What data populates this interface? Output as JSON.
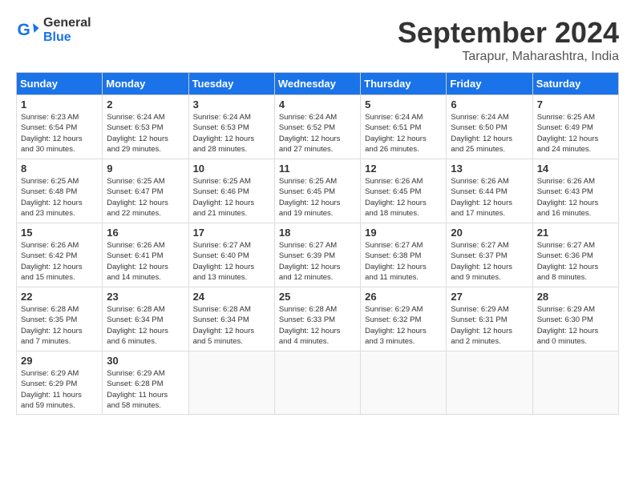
{
  "logo": {
    "text_general": "General",
    "text_blue": "Blue"
  },
  "header": {
    "month": "September 2024",
    "location": "Tarapur, Maharashtra, India"
  },
  "weekdays": [
    "Sunday",
    "Monday",
    "Tuesday",
    "Wednesday",
    "Thursday",
    "Friday",
    "Saturday"
  ],
  "weeks": [
    [
      {
        "day": "1",
        "info": "Sunrise: 6:23 AM\nSunset: 6:54 PM\nDaylight: 12 hours\nand 30 minutes."
      },
      {
        "day": "2",
        "info": "Sunrise: 6:24 AM\nSunset: 6:53 PM\nDaylight: 12 hours\nand 29 minutes."
      },
      {
        "day": "3",
        "info": "Sunrise: 6:24 AM\nSunset: 6:53 PM\nDaylight: 12 hours\nand 28 minutes."
      },
      {
        "day": "4",
        "info": "Sunrise: 6:24 AM\nSunset: 6:52 PM\nDaylight: 12 hours\nand 27 minutes."
      },
      {
        "day": "5",
        "info": "Sunrise: 6:24 AM\nSunset: 6:51 PM\nDaylight: 12 hours\nand 26 minutes."
      },
      {
        "day": "6",
        "info": "Sunrise: 6:24 AM\nSunset: 6:50 PM\nDaylight: 12 hours\nand 25 minutes."
      },
      {
        "day": "7",
        "info": "Sunrise: 6:25 AM\nSunset: 6:49 PM\nDaylight: 12 hours\nand 24 minutes."
      }
    ],
    [
      {
        "day": "8",
        "info": "Sunrise: 6:25 AM\nSunset: 6:48 PM\nDaylight: 12 hours\nand 23 minutes."
      },
      {
        "day": "9",
        "info": "Sunrise: 6:25 AM\nSunset: 6:47 PM\nDaylight: 12 hours\nand 22 minutes."
      },
      {
        "day": "10",
        "info": "Sunrise: 6:25 AM\nSunset: 6:46 PM\nDaylight: 12 hours\nand 21 minutes."
      },
      {
        "day": "11",
        "info": "Sunrise: 6:25 AM\nSunset: 6:45 PM\nDaylight: 12 hours\nand 19 minutes."
      },
      {
        "day": "12",
        "info": "Sunrise: 6:26 AM\nSunset: 6:45 PM\nDaylight: 12 hours\nand 18 minutes."
      },
      {
        "day": "13",
        "info": "Sunrise: 6:26 AM\nSunset: 6:44 PM\nDaylight: 12 hours\nand 17 minutes."
      },
      {
        "day": "14",
        "info": "Sunrise: 6:26 AM\nSunset: 6:43 PM\nDaylight: 12 hours\nand 16 minutes."
      }
    ],
    [
      {
        "day": "15",
        "info": "Sunrise: 6:26 AM\nSunset: 6:42 PM\nDaylight: 12 hours\nand 15 minutes."
      },
      {
        "day": "16",
        "info": "Sunrise: 6:26 AM\nSunset: 6:41 PM\nDaylight: 12 hours\nand 14 minutes."
      },
      {
        "day": "17",
        "info": "Sunrise: 6:27 AM\nSunset: 6:40 PM\nDaylight: 12 hours\nand 13 minutes."
      },
      {
        "day": "18",
        "info": "Sunrise: 6:27 AM\nSunset: 6:39 PM\nDaylight: 12 hours\nand 12 minutes."
      },
      {
        "day": "19",
        "info": "Sunrise: 6:27 AM\nSunset: 6:38 PM\nDaylight: 12 hours\nand 11 minutes."
      },
      {
        "day": "20",
        "info": "Sunrise: 6:27 AM\nSunset: 6:37 PM\nDaylight: 12 hours\nand 9 minutes."
      },
      {
        "day": "21",
        "info": "Sunrise: 6:27 AM\nSunset: 6:36 PM\nDaylight: 12 hours\nand 8 minutes."
      }
    ],
    [
      {
        "day": "22",
        "info": "Sunrise: 6:28 AM\nSunset: 6:35 PM\nDaylight: 12 hours\nand 7 minutes."
      },
      {
        "day": "23",
        "info": "Sunrise: 6:28 AM\nSunset: 6:34 PM\nDaylight: 12 hours\nand 6 minutes."
      },
      {
        "day": "24",
        "info": "Sunrise: 6:28 AM\nSunset: 6:34 PM\nDaylight: 12 hours\nand 5 minutes."
      },
      {
        "day": "25",
        "info": "Sunrise: 6:28 AM\nSunset: 6:33 PM\nDaylight: 12 hours\nand 4 minutes."
      },
      {
        "day": "26",
        "info": "Sunrise: 6:29 AM\nSunset: 6:32 PM\nDaylight: 12 hours\nand 3 minutes."
      },
      {
        "day": "27",
        "info": "Sunrise: 6:29 AM\nSunset: 6:31 PM\nDaylight: 12 hours\nand 2 minutes."
      },
      {
        "day": "28",
        "info": "Sunrise: 6:29 AM\nSunset: 6:30 PM\nDaylight: 12 hours\nand 0 minutes."
      }
    ],
    [
      {
        "day": "29",
        "info": "Sunrise: 6:29 AM\nSunset: 6:29 PM\nDaylight: 11 hours\nand 59 minutes."
      },
      {
        "day": "30",
        "info": "Sunrise: 6:29 AM\nSunset: 6:28 PM\nDaylight: 11 hours\nand 58 minutes."
      },
      null,
      null,
      null,
      null,
      null
    ]
  ]
}
